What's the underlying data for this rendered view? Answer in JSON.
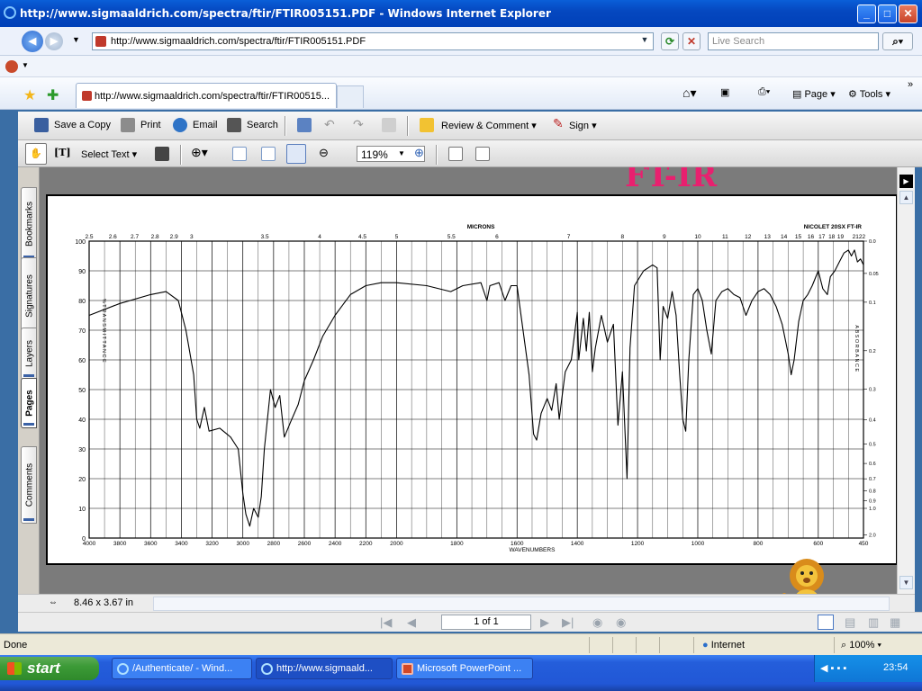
{
  "window": {
    "title": "http://www.sigmaaldrich.com/spectra/ftir/FTIR005151.PDF - Windows Internet Explorer",
    "min": "_",
    "max": "□",
    "close": "✕"
  },
  "address": {
    "url": "http://www.sigmaaldrich.com/spectra/ftir/FTIR005151.PDF",
    "search_placeholder": "Live Search"
  },
  "tabs": [
    {
      "label": "http://www.sigmaaldrich.com/spectra/ftir/FTIR00515..."
    }
  ],
  "command_bar": {
    "page": "Page",
    "tools": "Tools"
  },
  "acrobat_toolbar1": {
    "save_copy": "Save a Copy",
    "print": "Print",
    "email": "Email",
    "search": "Search",
    "review_comment": "Review & Comment",
    "sign": "Sign"
  },
  "acrobat_toolbar2": {
    "select_text": "Select Text",
    "zoom": "119%"
  },
  "side_tabs": [
    "Bookmarks",
    "Signatures",
    "Layers",
    "Pages",
    "Comments"
  ],
  "overlay": {
    "heading": "FT-IR"
  },
  "spectrum": {
    "top_axis_label": "MICRONS",
    "instrument": "NICOLET 20SX FT-IR",
    "bottom_axis_label": "WAVENUMBERS",
    "left_axis_label": "%TRANSMITTANCE",
    "right_axis_label": "ABSORBANCE",
    "micron_ticks": [
      "2.5",
      "2.6",
      "2.7",
      "2.8",
      "2.9",
      "3",
      "3.5",
      "4",
      "4.5",
      "5",
      "5.5",
      "6",
      "7",
      "8",
      "9",
      "10",
      "11",
      "12",
      "13",
      "14",
      "15",
      "16",
      "17",
      "18",
      "19",
      "21",
      "22"
    ],
    "wavenumber_ticks": [
      "4000",
      "3800",
      "3600",
      "3400",
      "3200",
      "3000",
      "2800",
      "2600",
      "2400",
      "2200",
      "2000",
      "1800",
      "1600",
      "1400",
      "1200",
      "1000",
      "800",
      "600",
      "450"
    ],
    "transmittance_ticks": [
      "100",
      "90",
      "80",
      "70",
      "60",
      "50",
      "40",
      "30",
      "20",
      "10",
      "0"
    ],
    "absorbance_ticks": [
      "0.0",
      "0.05",
      "0.1",
      "0.2",
      "0.3",
      "0.4",
      "0.5",
      "0.6",
      "0.7",
      "0.8",
      "0.9",
      "1.0",
      "2.0"
    ]
  },
  "chart_data": {
    "type": "line",
    "title": "",
    "xlabel": "WAVENUMBERS",
    "ylabel": "%TRANSMITTANCE",
    "x_reversed": true,
    "xlim": [
      4000,
      450
    ],
    "ylim": [
      0,
      100
    ],
    "grid": true,
    "series": [
      {
        "values": [
          [
            4000,
            75
          ],
          [
            3800,
            79
          ],
          [
            3600,
            82
          ],
          [
            3500,
            83
          ],
          [
            3420,
            80
          ],
          [
            3370,
            70
          ],
          [
            3320,
            55
          ],
          [
            3300,
            40
          ],
          [
            3280,
            37
          ],
          [
            3250,
            44
          ],
          [
            3220,
            36
          ],
          [
            3150,
            37
          ],
          [
            3080,
            34
          ],
          [
            3030,
            30
          ],
          [
            3000,
            15
          ],
          [
            2980,
            8
          ],
          [
            2955,
            4
          ],
          [
            2930,
            10
          ],
          [
            2900,
            7
          ],
          [
            2880,
            14
          ],
          [
            2860,
            30
          ],
          [
            2840,
            40
          ],
          [
            2820,
            50
          ],
          [
            2790,
            44
          ],
          [
            2760,
            48
          ],
          [
            2730,
            34
          ],
          [
            2690,
            39
          ],
          [
            2640,
            45
          ],
          [
            2600,
            53
          ],
          [
            2540,
            60
          ],
          [
            2480,
            68
          ],
          [
            2400,
            75
          ],
          [
            2300,
            82
          ],
          [
            2200,
            85
          ],
          [
            2100,
            86
          ],
          [
            2000,
            86
          ],
          [
            1900,
            85
          ],
          [
            1820,
            83
          ],
          [
            1780,
            85
          ],
          [
            1720,
            86
          ],
          [
            1700,
            80
          ],
          [
            1690,
            85
          ],
          [
            1660,
            86
          ],
          [
            1640,
            80
          ],
          [
            1620,
            85
          ],
          [
            1600,
            85
          ],
          [
            1580,
            70
          ],
          [
            1560,
            55
          ],
          [
            1545,
            35
          ],
          [
            1535,
            33
          ],
          [
            1520,
            42
          ],
          [
            1500,
            47
          ],
          [
            1485,
            43
          ],
          [
            1470,
            52
          ],
          [
            1460,
            40
          ],
          [
            1450,
            48
          ],
          [
            1440,
            56
          ],
          [
            1420,
            60
          ],
          [
            1400,
            76
          ],
          [
            1395,
            60
          ],
          [
            1380,
            74
          ],
          [
            1370,
            63
          ],
          [
            1360,
            76
          ],
          [
            1350,
            56
          ],
          [
            1340,
            64
          ],
          [
            1320,
            75
          ],
          [
            1300,
            66
          ],
          [
            1280,
            72
          ],
          [
            1265,
            38
          ],
          [
            1250,
            56
          ],
          [
            1235,
            20
          ],
          [
            1225,
            64
          ],
          [
            1210,
            85
          ],
          [
            1180,
            90
          ],
          [
            1150,
            92
          ],
          [
            1135,
            91
          ],
          [
            1125,
            60
          ],
          [
            1115,
            78
          ],
          [
            1100,
            74
          ],
          [
            1085,
            83
          ],
          [
            1072,
            75
          ],
          [
            1060,
            55
          ],
          [
            1050,
            40
          ],
          [
            1040,
            36
          ],
          [
            1030,
            60
          ],
          [
            1015,
            82
          ],
          [
            1000,
            84
          ],
          [
            985,
            80
          ],
          [
            970,
            70
          ],
          [
            955,
            62
          ],
          [
            940,
            80
          ],
          [
            920,
            83
          ],
          [
            900,
            84
          ],
          [
            880,
            82
          ],
          [
            860,
            81
          ],
          [
            840,
            75
          ],
          [
            820,
            80
          ],
          [
            800,
            83
          ],
          [
            780,
            84
          ],
          [
            760,
            82
          ],
          [
            740,
            78
          ],
          [
            720,
            72
          ],
          [
            700,
            62
          ],
          [
            690,
            55
          ],
          [
            680,
            60
          ],
          [
            665,
            73
          ],
          [
            650,
            80
          ],
          [
            635,
            82
          ],
          [
            620,
            85
          ],
          [
            600,
            90
          ],
          [
            585,
            84
          ],
          [
            570,
            82
          ],
          [
            560,
            88
          ],
          [
            545,
            90
          ],
          [
            530,
            93
          ],
          [
            515,
            96
          ],
          [
            500,
            97
          ],
          [
            490,
            95
          ],
          [
            480,
            97
          ],
          [
            470,
            93
          ],
          [
            460,
            94
          ],
          [
            450,
            92
          ]
        ]
      }
    ]
  },
  "document": {
    "dimensions": "8.46 x 3.67 in",
    "page_indicator": "1 of 1"
  },
  "status": {
    "text": "Done",
    "zone": "Internet",
    "zoom": "100%"
  },
  "taskbar": {
    "start": "start",
    "tasks": [
      "/Authenticate/ - Wind...",
      "http://www.sigmaald...",
      "Microsoft PowerPoint ..."
    ],
    "clock": "23:54"
  }
}
